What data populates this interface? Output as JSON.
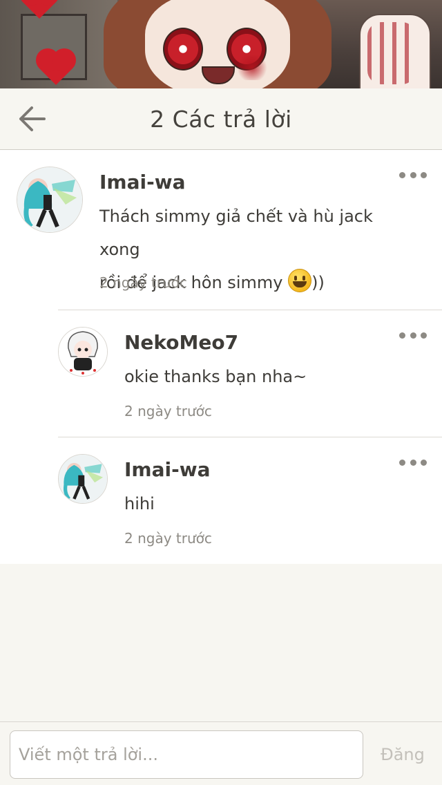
{
  "header": {
    "title": "2 Các trả lời",
    "back_icon": "arrow-left-icon"
  },
  "replies": [
    {
      "username": "Imai-wa",
      "text_line1": "Thách simmy giả chết và hù jack xong",
      "text_line2_before": "rồi để jack hôn simmy ",
      "text_line2_after": "))",
      "emoji": "grinning-face-icon",
      "timestamp": "2 ngày trước",
      "avatar": "miku-avatar"
    },
    {
      "username": "NekoMeo7",
      "text": "okie thanks bạn nha~",
      "timestamp": "2 ngày trước",
      "avatar": "white-hair-chibi-avatar"
    },
    {
      "username": "Imai-wa",
      "text": "hihi",
      "timestamp": "2 ngày trước",
      "avatar": "miku-avatar"
    }
  ],
  "composer": {
    "placeholder": "Viết một trả lời...",
    "post_label": "Đăng"
  },
  "colors": {
    "background": "#f7f6f1",
    "card": "#ffffff",
    "text": "#3e3c38",
    "muted": "#8d8a84",
    "post_disabled": "#c3c0ba"
  }
}
